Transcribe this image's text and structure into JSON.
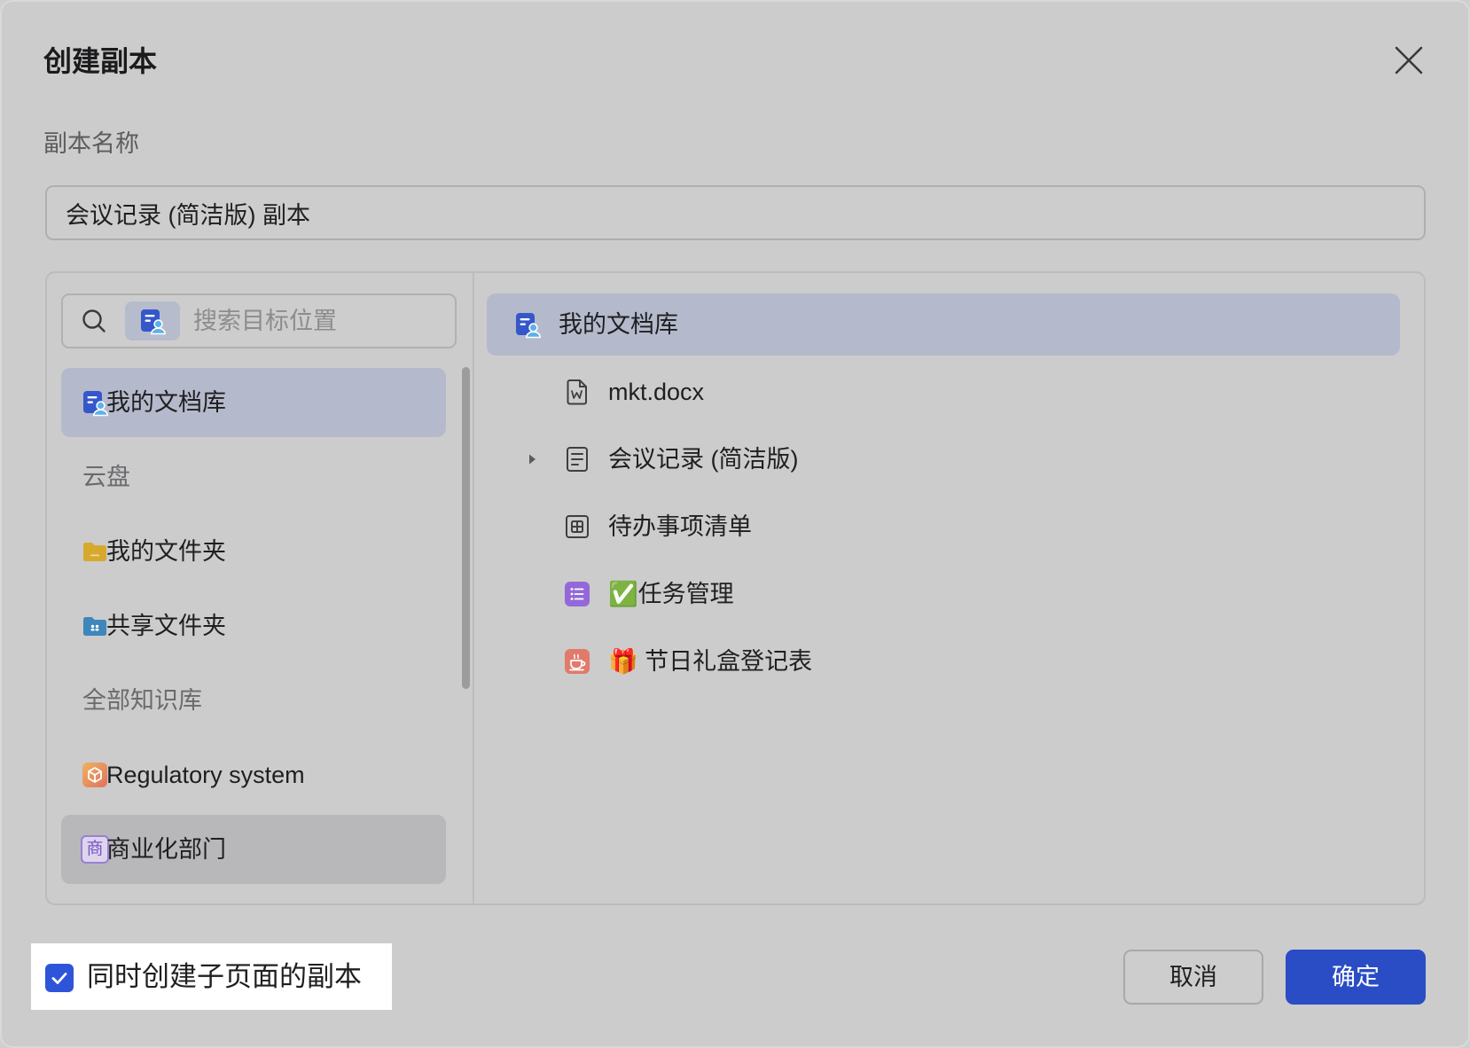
{
  "dialog": {
    "title": "创建副本"
  },
  "name_field": {
    "label": "副本名称",
    "value": "会议记录 (简洁版) 副本"
  },
  "search": {
    "placeholder": "搜索目标位置",
    "scope_icon": "doc-library-icon"
  },
  "left_nav": {
    "items": [
      {
        "label": "我的文档库",
        "icon": "doc-library-icon",
        "selected": true
      },
      {
        "label": "云盘",
        "section": true
      },
      {
        "label": "我的文件夹",
        "icon": "folder-icon"
      },
      {
        "label": "共享文件夹",
        "icon": "shared-folder-icon"
      },
      {
        "label": "全部知识库",
        "section": true
      },
      {
        "label": "Regulatory system",
        "icon": "cube-icon"
      },
      {
        "label": "商业化部门",
        "icon": "text-badge-icon",
        "badge": "商",
        "hovered": true
      }
    ]
  },
  "tree": {
    "root": {
      "label": "我的文档库",
      "icon": "doc-library-icon",
      "selected": true
    },
    "children": [
      {
        "label": "mkt.docx",
        "icon": "word-file-icon",
        "expandable": false
      },
      {
        "label": "会议记录 (简洁版)",
        "icon": "doc-icon",
        "expandable": true
      },
      {
        "label": "待办事项清单",
        "icon": "sheet-icon",
        "expandable": false
      },
      {
        "label": "✅任务管理",
        "icon": "task-list-icon",
        "expandable": false
      },
      {
        "label": "🎁 节日礼盒登记表",
        "icon": "form-icon",
        "expandable": false
      }
    ]
  },
  "footer": {
    "include_subpages": {
      "label": "同时创建子页面的副本",
      "checked": true
    },
    "cancel_label": "取消",
    "confirm_label": "确定"
  },
  "colors": {
    "accent": "#2a4dc6",
    "checkbox": "#2e55d9",
    "selected_bg": "#b4bacb",
    "hover_bg": "#b8b8ba",
    "dialog_bg": "#cccccc"
  }
}
